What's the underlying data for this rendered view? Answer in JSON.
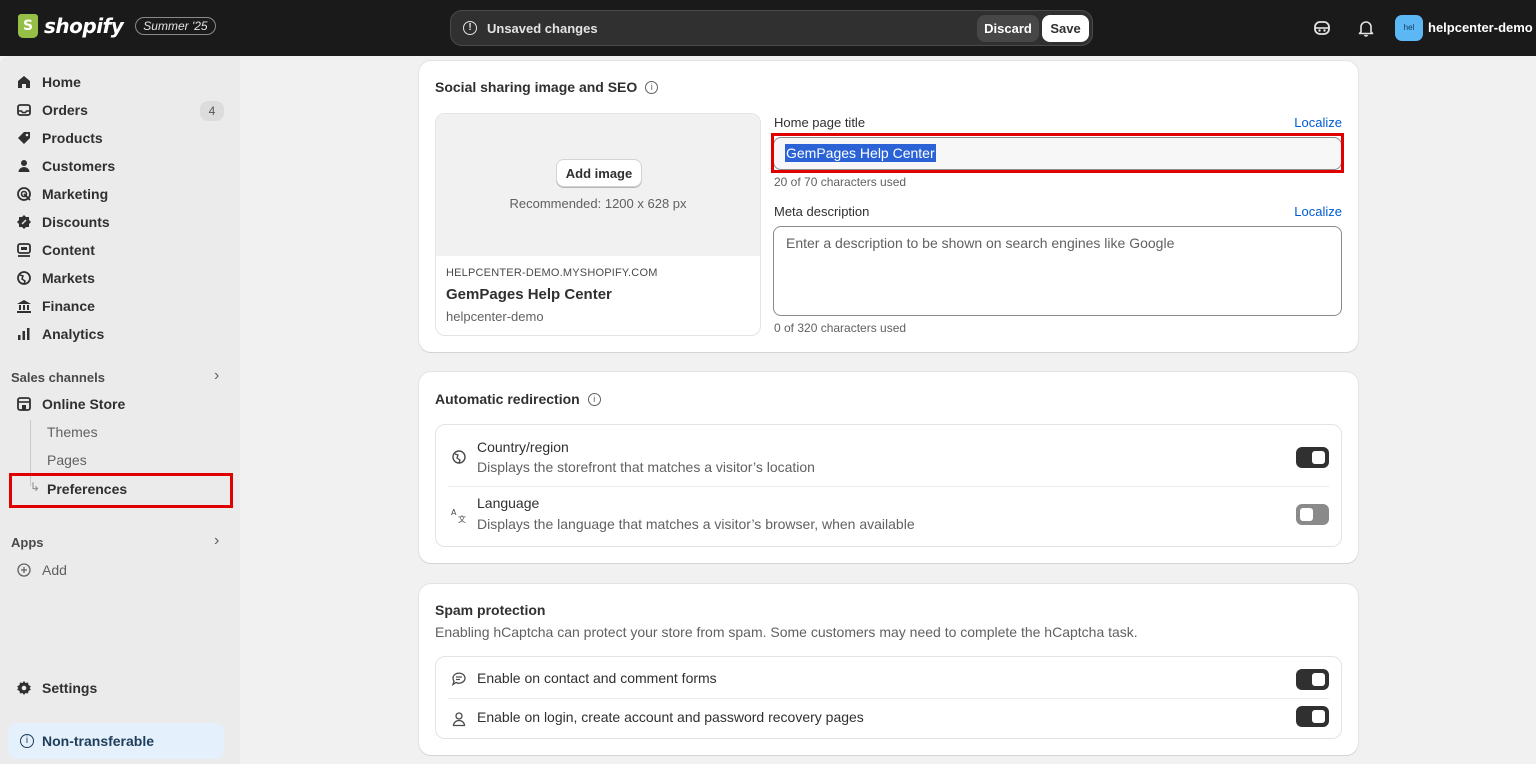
{
  "topbar": {
    "logo_text": "shopify",
    "edition": "Summer '25",
    "unsaved_text": "Unsaved changes",
    "discard_label": "Discard",
    "save_label": "Save",
    "store_badge": "hel",
    "store_name": "helpcenter-demo"
  },
  "sidebar": {
    "items": [
      {
        "label": "Home",
        "icon": "home-icon"
      },
      {
        "label": "Orders",
        "icon": "inbox-icon",
        "count": "4"
      },
      {
        "label": "Products",
        "icon": "tag-icon"
      },
      {
        "label": "Customers",
        "icon": "person-icon"
      },
      {
        "label": "Marketing",
        "icon": "target-icon"
      },
      {
        "label": "Discounts",
        "icon": "discount-icon"
      },
      {
        "label": "Content",
        "icon": "content-icon"
      },
      {
        "label": "Markets",
        "icon": "globe-icon"
      },
      {
        "label": "Finance",
        "icon": "bank-icon"
      },
      {
        "label": "Analytics",
        "icon": "bar-chart-icon"
      }
    ],
    "sales_channels_title": "Sales channels",
    "online_store_label": "Online Store",
    "online_store_subitems": [
      "Themes",
      "Pages",
      "Preferences"
    ],
    "apps_title": "Apps",
    "add_label": "Add",
    "settings_label": "Settings",
    "non_transferable_label": "Non-transferable"
  },
  "seo_card": {
    "title": "Social sharing image and SEO",
    "add_image_label": "Add image",
    "recommended": "Recommended: 1200 x 628 px",
    "preview_domain": "HELPCENTER-DEMO.MYSHOPIFY.COM",
    "preview_title": "GemPages Help Center",
    "preview_handle": "helpcenter-demo",
    "home_title_label": "Home page title",
    "localize_label": "Localize",
    "home_title_value": "GemPages Help Center",
    "home_title_helper": "20 of 70 characters used",
    "meta_label": "Meta description",
    "meta_placeholder": "Enter a description to be shown on search engines like Google",
    "meta_helper": "0 of 320 characters used"
  },
  "redirection_card": {
    "title": "Automatic redirection",
    "rows": [
      {
        "title": "Country/region",
        "desc": "Displays the storefront that matches a visitor’s location",
        "enabled": true,
        "icon": "globe-icon"
      },
      {
        "title": "Language",
        "desc": "Displays the language that matches a visitor’s browser, when available",
        "enabled": false,
        "icon": "translate-icon"
      }
    ]
  },
  "spam_card": {
    "title": "Spam protection",
    "subtitle": "Enabling hCaptcha can protect your store from spam. Some customers may need to complete the hCaptcha task.",
    "rows": [
      {
        "title": "Enable on contact and comment forms",
        "enabled": true,
        "icon": "chat-icon"
      },
      {
        "title": "Enable on login, create account and password recovery pages",
        "enabled": true,
        "icon": "person-icon"
      }
    ]
  },
  "colors": {
    "topbar": "#1a1a1a",
    "accent_link": "#005bd3",
    "highlight": "#e00000",
    "toggle_on": "#303030",
    "toggle_off": "#8a8a8a"
  }
}
